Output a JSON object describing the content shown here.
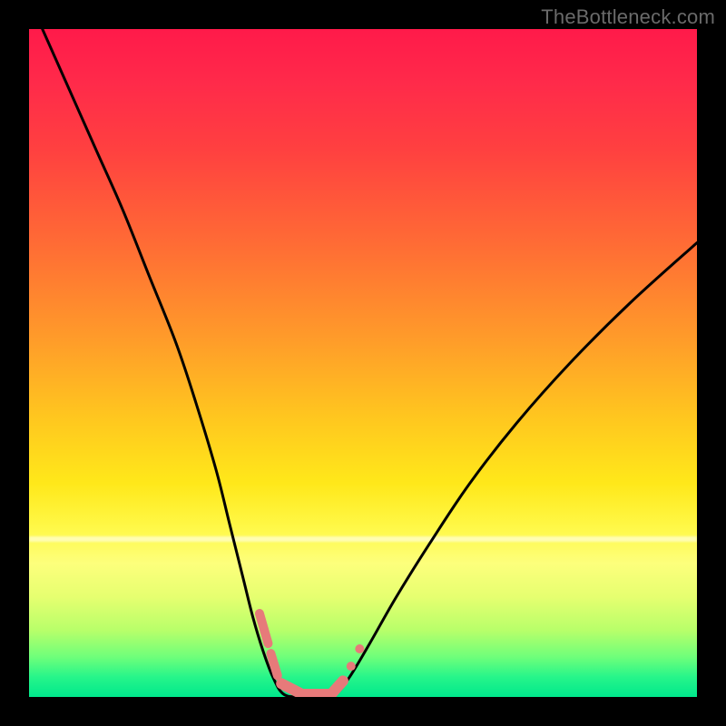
{
  "watermark": "TheBottleneck.com",
  "colors": {
    "background_frame": "#000000",
    "curve": "#000000",
    "marker_fill": "#e77a7a",
    "marker_stroke": "#c95a5a",
    "gradient_top": "#ff1a4a",
    "gradient_bottom": "#00e88c"
  },
  "chart_data": {
    "type": "line",
    "title": "",
    "xlabel": "",
    "ylabel": "",
    "xlim": [
      0,
      100
    ],
    "ylim": [
      0,
      100
    ],
    "series": [
      {
        "name": "left-branch",
        "x": [
          2,
          6,
          10,
          14,
          18,
          22,
          25,
          28,
          30,
          32,
          33.5,
          35,
          36.5,
          38
        ],
        "y": [
          100,
          91,
          82,
          73,
          63,
          53,
          44,
          34,
          26,
          18,
          12,
          7,
          3,
          0.5
        ]
      },
      {
        "name": "valley-floor",
        "x": [
          38,
          40,
          42,
          44,
          46
        ],
        "y": [
          0.5,
          0,
          0,
          0,
          0.5
        ]
      },
      {
        "name": "right-branch",
        "x": [
          46,
          48,
          51,
          55,
          60,
          66,
          73,
          81,
          90,
          100
        ],
        "y": [
          0.5,
          3,
          8,
          15,
          23,
          32,
          41,
          50,
          59,
          68
        ]
      }
    ],
    "markers": [
      {
        "shape": "pill",
        "x1": 34.5,
        "y1": 12.5,
        "x2": 35.8,
        "y2": 8.0,
        "r": 5
      },
      {
        "shape": "pill",
        "x1": 36.2,
        "y1": 6.5,
        "x2": 37.2,
        "y2": 3.2,
        "r": 5
      },
      {
        "shape": "pill",
        "x1": 37.8,
        "y1": 2.0,
        "x2": 40.5,
        "y2": 0.6,
        "r": 6
      },
      {
        "shape": "pill",
        "x1": 41.0,
        "y1": 0.4,
        "x2": 44.8,
        "y2": 0.4,
        "r": 6
      },
      {
        "shape": "pill",
        "x1": 45.4,
        "y1": 0.6,
        "x2": 47.0,
        "y2": 2.4,
        "r": 6
      },
      {
        "shape": "dot",
        "cx": 48.2,
        "cy": 4.6,
        "r": 5
      },
      {
        "shape": "dot",
        "cx": 49.5,
        "cy": 7.2,
        "r": 5
      }
    ]
  }
}
